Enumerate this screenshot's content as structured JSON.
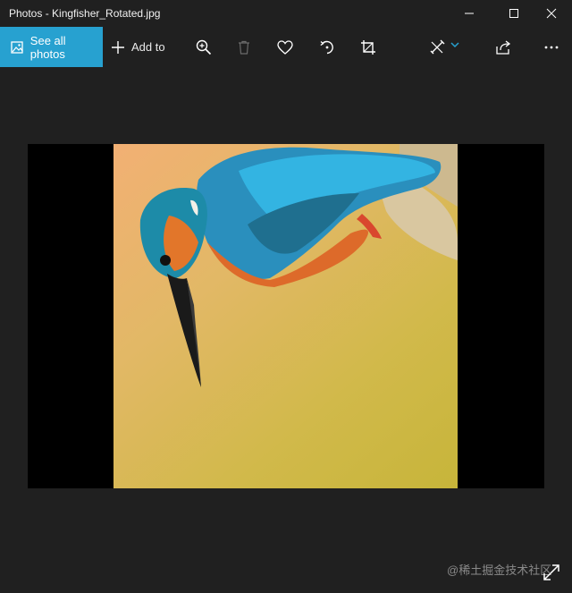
{
  "window": {
    "title": "Photos - Kingfisher_Rotated.jpg",
    "controls": [
      "minimize-icon",
      "maximize-icon",
      "close-icon"
    ]
  },
  "toolbar": {
    "see_all_label": "See all photos",
    "add_to_label": "Add to",
    "buttons": [
      "zoom-in-icon",
      "delete-icon",
      "heart-icon",
      "rotate-icon",
      "crop-icon",
      "edit-create-icon",
      "share-icon",
      "more-icon"
    ]
  },
  "image": {
    "subject": "kingfisher",
    "colors": {
      "accent": "#27a1d0",
      "background": "#202020",
      "letterbox": "#000000"
    }
  },
  "watermark": {
    "text": "@稀土掘金技术社区"
  }
}
